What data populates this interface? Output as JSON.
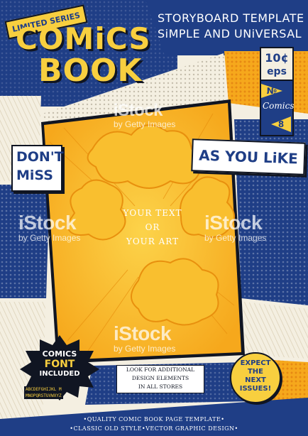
{
  "colors": {
    "navy": "#1f3e86",
    "orange": "#f6a81c",
    "yellow": "#f8cf3f",
    "cream": "#f4efe1",
    "ink": "#101522"
  },
  "banner": {
    "limited_series": "LIMITED SERIES"
  },
  "title": {
    "line1": "COMiCS",
    "line2": "BOOK"
  },
  "header": {
    "line1": "STORYBOARD TEMPLATE",
    "line2": "SiMPLE AND UNiVERSAL"
  },
  "price": {
    "amount": "10¢",
    "unit": "eps"
  },
  "issue": {
    "no_label": "№",
    "brand": "Comics",
    "number": "8"
  },
  "callouts": {
    "dont": "DON'T",
    "miss": "MiSS",
    "as_you_like": "AS YOU LiKE"
  },
  "center_panel": {
    "line1": "YOUR TEXT",
    "line2": "OR",
    "line3": "YOUR ART"
  },
  "font_badge": {
    "comics": "COMICS",
    "font": "FONT",
    "included": "INCLUDED",
    "alphabet1": "ABCDEFGHIJKL M",
    "alphabet2": "MNOPQRSTUVWXYZ"
  },
  "info_box": {
    "line1": "LOOK FOR ADDITIONAL",
    "line2": "DESIGN ELEMENTS",
    "line3": "IN ALL STORES"
  },
  "expect_badge": {
    "line1": "EXPECT",
    "line2": "THE",
    "line3": "NEXT",
    "line4": "ISSUES!"
  },
  "footer": {
    "line1": "•QUALITY COMIC BOOK PAGE TEMPLATE•",
    "line2": "•CLASSIC OLD STYLE•VECTOR GRAPHIC DESIGN•"
  },
  "watermarks": {
    "brand": "iStock",
    "sub": "by Getty Images"
  }
}
